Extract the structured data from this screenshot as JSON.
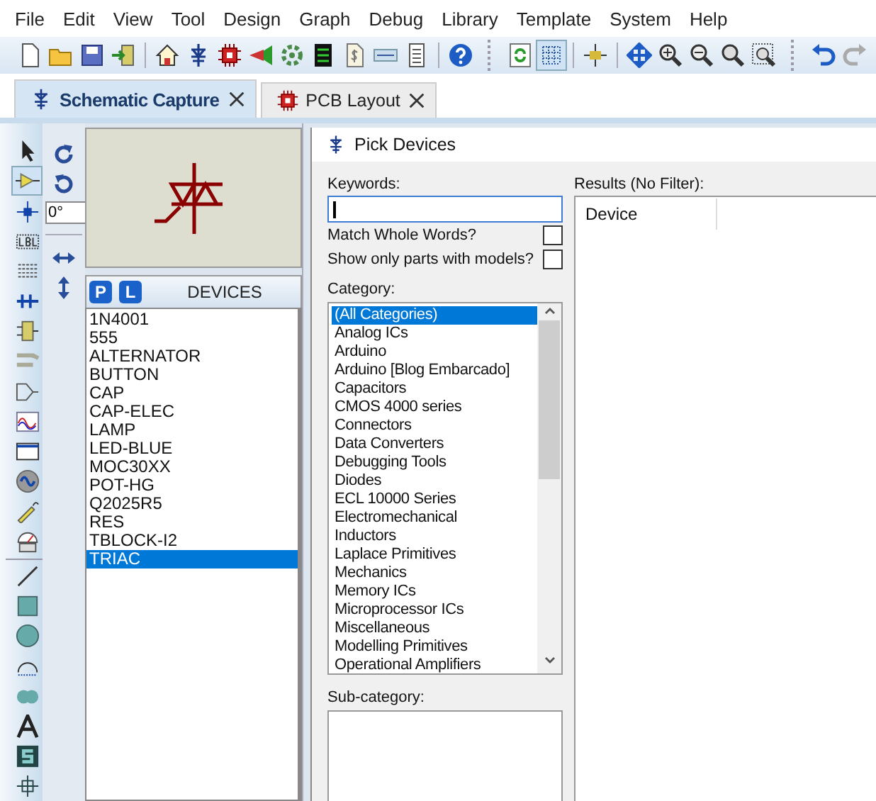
{
  "menu": [
    "File",
    "Edit",
    "View",
    "Tool",
    "Design",
    "Graph",
    "Debug",
    "Library",
    "Template",
    "System",
    "Help"
  ],
  "tabs": [
    {
      "label": "Schematic Capture",
      "selected": true
    },
    {
      "label": "PCB Layout",
      "selected": false
    }
  ],
  "orientation": {
    "angle": "0°"
  },
  "devices": {
    "pick_button": "P",
    "library_button": "L",
    "title": "DEVICES",
    "items": [
      {
        "label": "1N4001",
        "selected": false
      },
      {
        "label": "555",
        "selected": false
      },
      {
        "label": "ALTERNATOR",
        "selected": false
      },
      {
        "label": "BUTTON",
        "selected": false
      },
      {
        "label": "CAP",
        "selected": false
      },
      {
        "label": "CAP-ELEC",
        "selected": false
      },
      {
        "label": "LAMP",
        "selected": false
      },
      {
        "label": "LED-BLUE",
        "selected": false
      },
      {
        "label": "MOC30XX",
        "selected": false
      },
      {
        "label": "POT-HG",
        "selected": false
      },
      {
        "label": "Q2025R5",
        "selected": false
      },
      {
        "label": "RES",
        "selected": false
      },
      {
        "label": "TBLOCK-I2",
        "selected": false
      },
      {
        "label": "TRIAC",
        "selected": true
      }
    ]
  },
  "dialog": {
    "title": "Pick Devices",
    "keywords_label": "Keywords:",
    "options": [
      {
        "label": "Match Whole Words?",
        "checked": false
      },
      {
        "label": "Show only parts with models?",
        "checked": false
      }
    ],
    "category_label": "Category:",
    "categories": [
      {
        "label": "(All Categories)",
        "selected": true
      },
      {
        "label": "Analog ICs",
        "selected": false
      },
      {
        "label": "Arduino",
        "selected": false
      },
      {
        "label": "Arduino [Blog Embarcado]",
        "selected": false
      },
      {
        "label": "Capacitors",
        "selected": false
      },
      {
        "label": "CMOS 4000 series",
        "selected": false
      },
      {
        "label": "Connectors",
        "selected": false
      },
      {
        "label": "Data Converters",
        "selected": false
      },
      {
        "label": "Debugging Tools",
        "selected": false
      },
      {
        "label": "Diodes",
        "selected": false
      },
      {
        "label": "ECL 10000 Series",
        "selected": false
      },
      {
        "label": "Electromechanical",
        "selected": false
      },
      {
        "label": "Inductors",
        "selected": false
      },
      {
        "label": "Laplace Primitives",
        "selected": false
      },
      {
        "label": "Mechanics",
        "selected": false
      },
      {
        "label": "Memory ICs",
        "selected": false
      },
      {
        "label": "Microprocessor ICs",
        "selected": false
      },
      {
        "label": "Miscellaneous",
        "selected": false
      },
      {
        "label": "Modelling Primitives",
        "selected": false
      },
      {
        "label": "Operational Amplifiers",
        "selected": false
      }
    ],
    "subcategory_label": "Sub-category:",
    "results_label": "Results (No Filter):",
    "results_columns": [
      "Device"
    ]
  }
}
